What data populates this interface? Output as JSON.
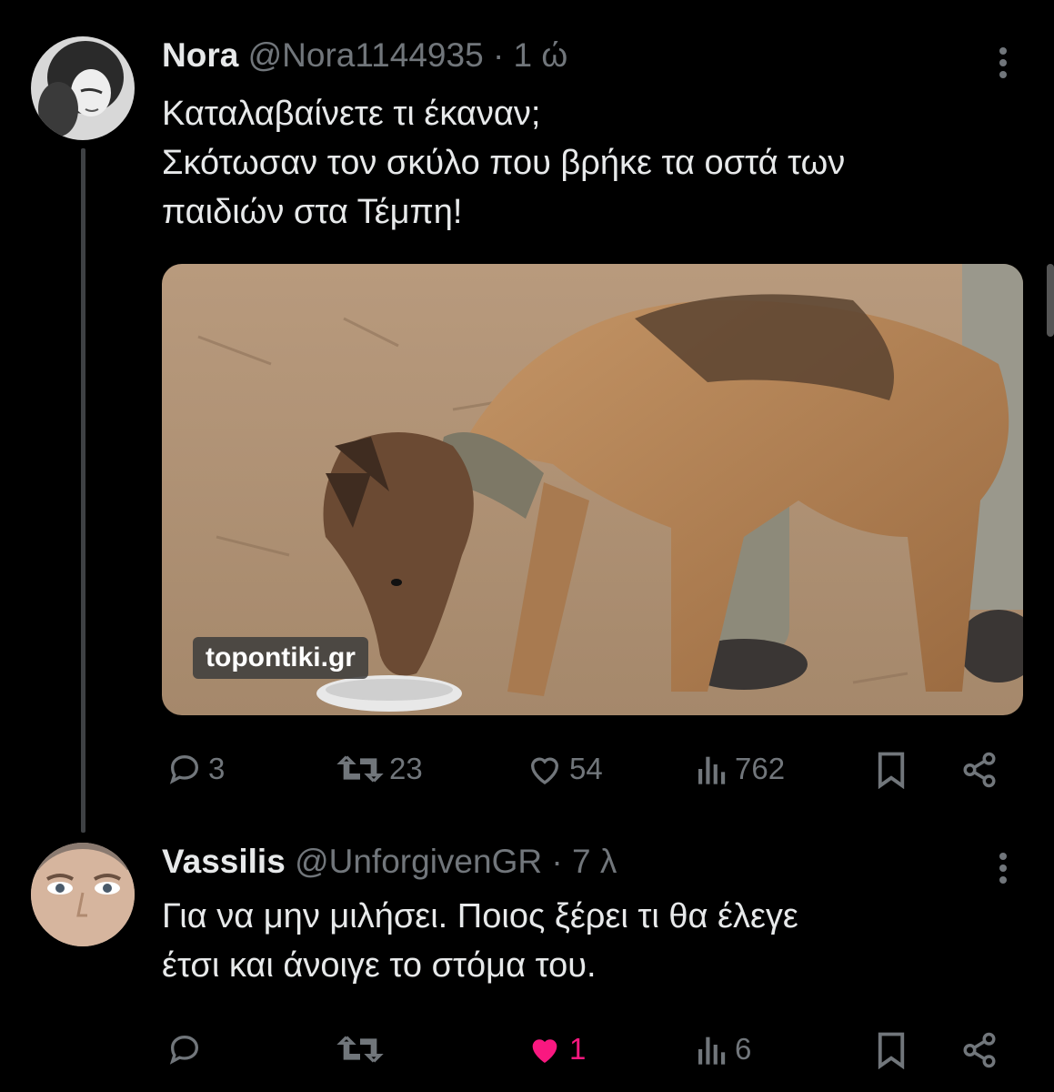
{
  "tweets": [
    {
      "name": "Nora",
      "handle": "@Nora1144935",
      "separator": "·",
      "time": "1 ώ",
      "text": "Καταλαβαίνετε τι έκαναν;\nΣκότωσαν τον σκύλο που βρήκε τα οστά των\nπαιδιών στα Τέμπη!",
      "media": {
        "watermark": "topontiki.gr",
        "description_icon": "dog-photo"
      },
      "actions": {
        "replies": "3",
        "retweets": "23",
        "likes": "54",
        "views": "762"
      }
    },
    {
      "name": "Vassilis",
      "handle": "@UnforgivenGR",
      "separator": "·",
      "time": "7 λ",
      "text": "Για να μην μιλήσει. Ποιος ξέρει τι θα έλεγε\nέτσι και άνοιγε το στόμα του.",
      "actions": {
        "replies": "",
        "retweets": "",
        "likes": "1",
        "views": "6"
      }
    }
  ],
  "colors": {
    "background": "#000000",
    "text": "#e7e9ea",
    "muted": "#71767b",
    "like_active": "#f91880"
  }
}
